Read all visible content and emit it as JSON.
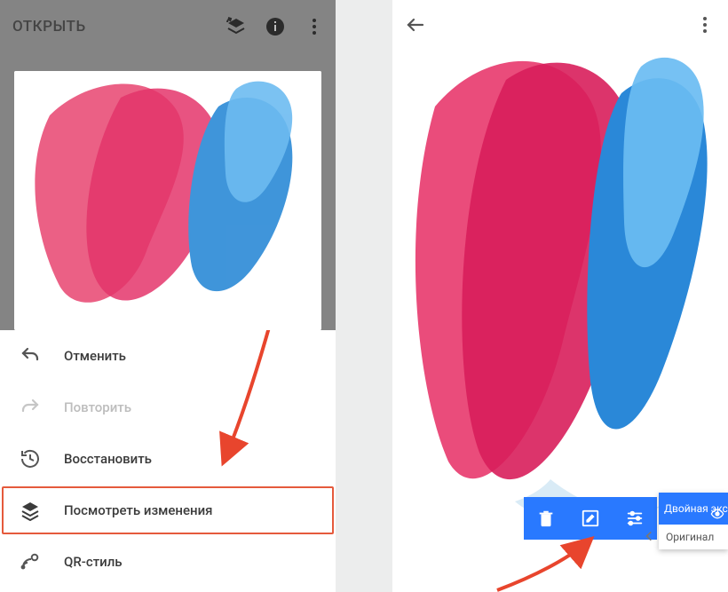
{
  "left": {
    "open_label": "ОТКРЫТЬ",
    "menu": {
      "undo": "Отменить",
      "redo": "Повторить",
      "revert": "Восстановить",
      "view": "Посмотреть изменения",
      "qr": "QR-стиль"
    }
  },
  "right": {
    "history": {
      "step_current": "Двойная экс…",
      "step_original": "Оригинал"
    }
  },
  "colors": {
    "accent_blue": "#2979ff",
    "highlight_red": "#e55a3c"
  }
}
